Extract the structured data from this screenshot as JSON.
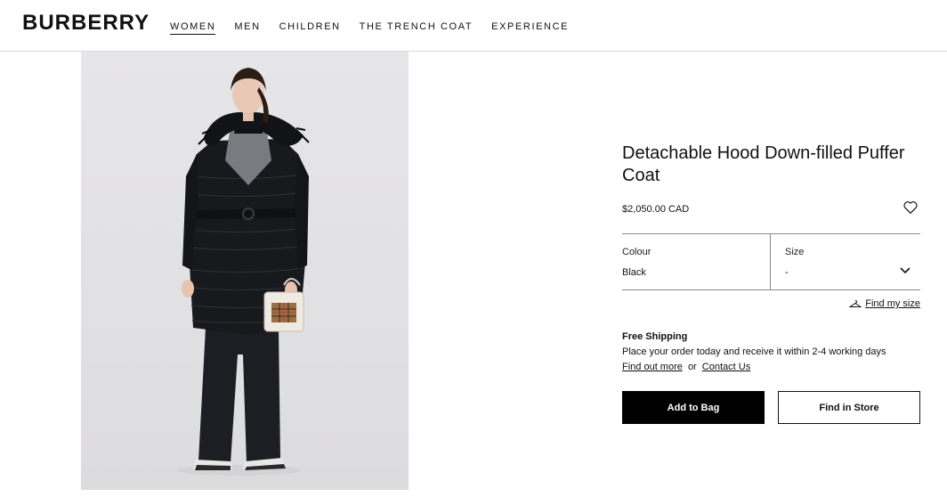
{
  "header": {
    "logo": "BURBERRY",
    "nav": [
      {
        "label": "WOMEN",
        "active": true
      },
      {
        "label": "MEN",
        "active": false
      },
      {
        "label": "CHILDREN",
        "active": false
      },
      {
        "label": "THE TRENCH COAT",
        "active": false
      },
      {
        "label": "EXPERIENCE",
        "active": false
      }
    ]
  },
  "product": {
    "title": "Detachable Hood Down-filled Puffer Coat",
    "price": "$2,050.00 CAD",
    "colour_label": "Colour",
    "colour_value": "Black",
    "size_label": "Size",
    "size_value": "-",
    "find_size": "Find my size",
    "shipping_head": "Free Shipping",
    "shipping_text": "Place your order today and receive it within 2-4 working days",
    "find_out_more": "Find out more",
    "or": "or",
    "contact_us": "Contact Us",
    "add_to_bag": "Add to Bag",
    "find_in_store": "Find in Store"
  },
  "icons": {
    "wishlist": "heart-icon",
    "size_dropdown": "chevron-down-icon",
    "find_size": "hanger-icon"
  },
  "colors": {
    "primary": "#000000",
    "background": "#ffffff",
    "border": "#8a8a8a"
  }
}
